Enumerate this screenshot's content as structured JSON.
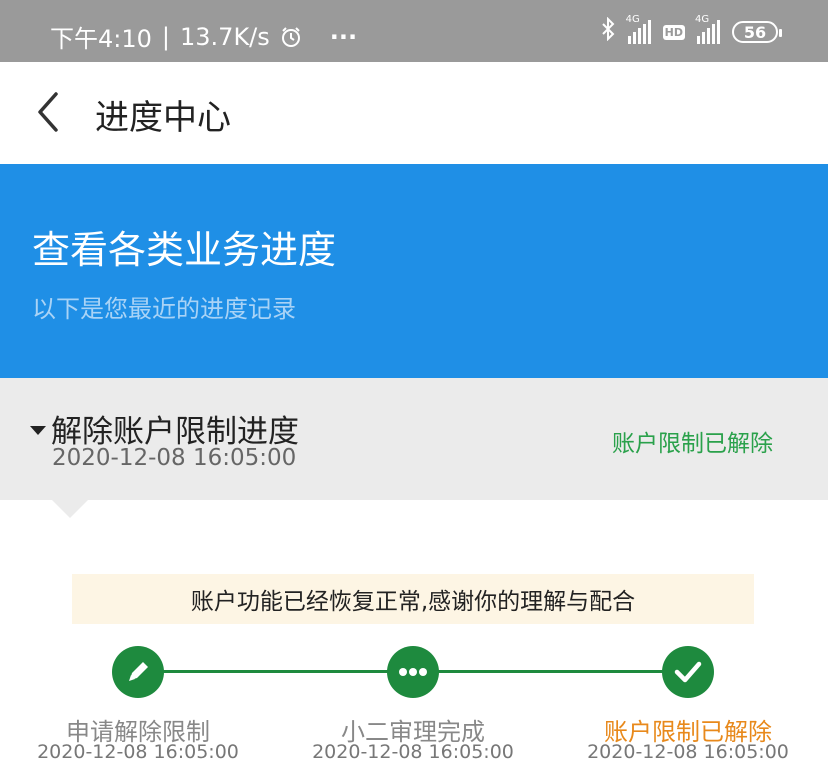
{
  "status_bar": {
    "time": "下午4:10",
    "speed": "13.7K/s",
    "more": "···",
    "net1": "4G",
    "hd": "HD",
    "net2": "4G",
    "battery": "56"
  },
  "header": {
    "title": "进度中心"
  },
  "banner": {
    "title": "查看各类业务进度",
    "subtitle": "以下是您最近的进度记录"
  },
  "record": {
    "title": "解除账户限制进度",
    "time": "2020-12-08 16:05:00",
    "status": "账户限制已解除",
    "status_color": "#2aa14b"
  },
  "notice": "账户功能已经恢复正常,感谢你的理解与配合",
  "steps": [
    {
      "label": "申请解除限制",
      "time": "2020-12-08 16:05:00",
      "icon": "pencil-icon"
    },
    {
      "label": "小二审理完成",
      "time": "2020-12-08 16:05:00",
      "icon": "dots-icon"
    },
    {
      "label": "账户限制已解除",
      "time": "2020-12-08 16:05:00",
      "icon": "check-icon"
    }
  ],
  "colors": {
    "banner": "#1f8fe6",
    "step_green": "#1e8a3e",
    "active_step": "#e8891b"
  }
}
